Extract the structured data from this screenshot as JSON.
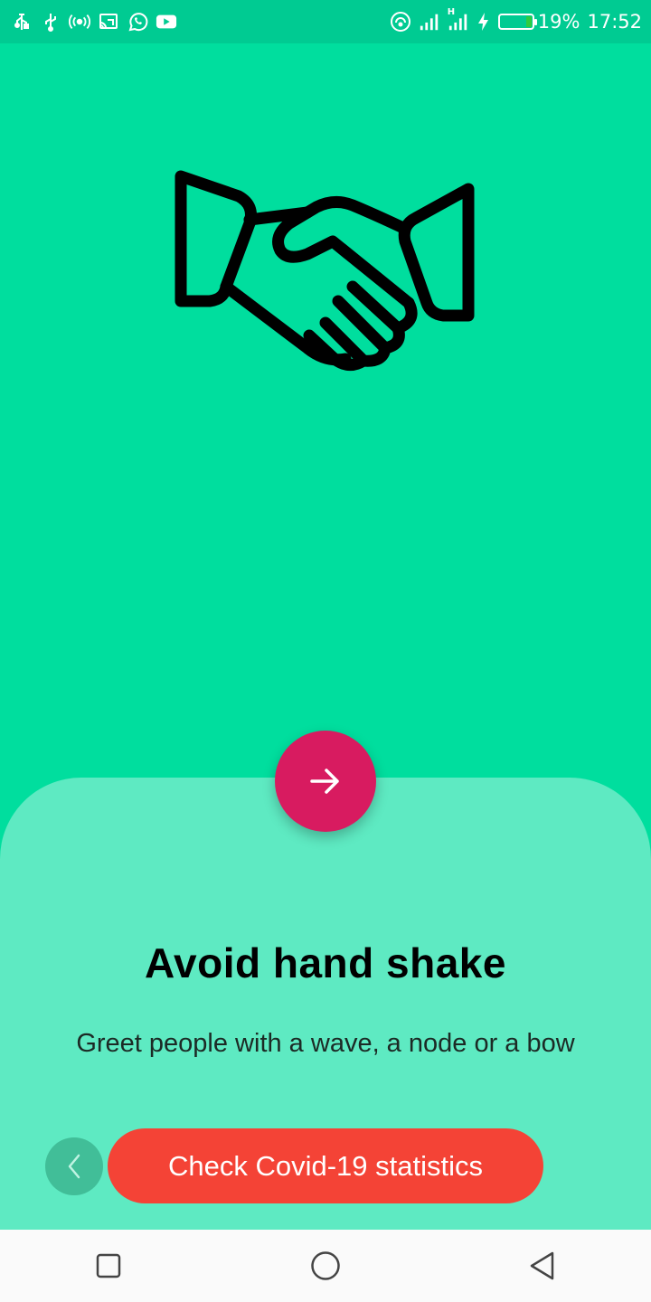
{
  "status_bar": {
    "left_icons": [
      "usb-debug-icon",
      "usb-icon",
      "hotspot-icon",
      "cast-icon",
      "whatsapp-icon",
      "youtube-icon"
    ],
    "right_icons": [
      "wifi-icon",
      "signal-icon",
      "signal-h-icon",
      "charging-icon",
      "battery-icon"
    ],
    "network_type": "H",
    "battery_percent": "19%",
    "time": "17:52",
    "battery_level": 0.19,
    "battery_color": "#2ECC40"
  },
  "onboarding": {
    "illustration": "handshake-icon",
    "title": "Avoid hand shake",
    "subtitle": "Greet people with a wave, a node or a bow",
    "next_icon": "arrow-right-icon",
    "back_icon": "chevron-left-icon",
    "cta_label": "Check Covid-19 statistics"
  },
  "colors": {
    "background": "#00DE9E",
    "status_bar": "#00CB92",
    "sheet": "#5EEAC2",
    "next_button": "#D81B60",
    "cta_button": "#F44336",
    "back_button": "#41BE98"
  },
  "nav_bar": {
    "buttons": [
      "recents-icon",
      "home-icon",
      "back-icon"
    ]
  }
}
